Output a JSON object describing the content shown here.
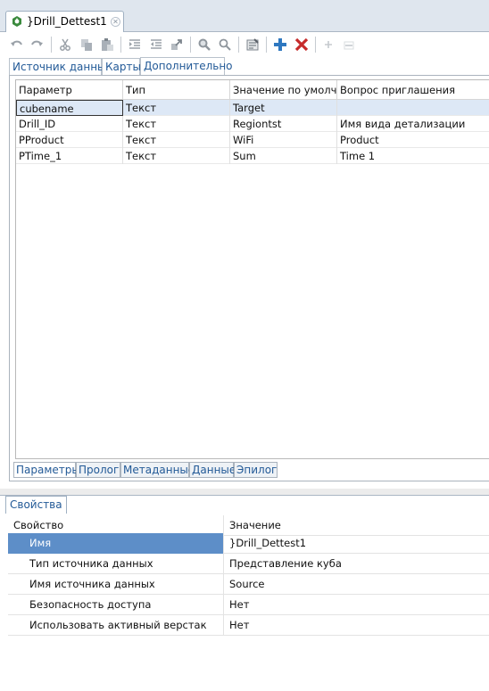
{
  "editor": {
    "tab_title": "}Drill_Dettest1",
    "tabs": [
      "Источник данных",
      "Карты",
      "Дополнительно"
    ],
    "grid": {
      "columns": [
        "Параметр",
        "Тип",
        "Значение по умолча",
        "Вопрос приглашения"
      ],
      "rows": [
        [
          "cubename",
          "Текст",
          "Target",
          ""
        ],
        [
          "Drill_ID",
          "Текст",
          "Regiontst",
          "Имя вида детализации"
        ],
        [
          "PProduct",
          "Текст",
          "WiFi",
          "Product"
        ],
        [
          "PTime_1",
          "Текст",
          "Sum",
          "Time 1"
        ]
      ]
    },
    "bottom_tabs": [
      "Параметры",
      "Пролог",
      "Метаданные",
      "Данные",
      "Эпилог"
    ]
  },
  "properties": {
    "tab_label": "Свойства",
    "columns": [
      "Свойство",
      "Значение"
    ],
    "rows": [
      [
        "Имя",
        "}Drill_Dettest1"
      ],
      [
        "Тип источника данных",
        "Представление куба"
      ],
      [
        "Имя источника данных",
        "Source"
      ],
      [
        "Безопасность доступа",
        "Нет"
      ],
      [
        "Использовать активный верстак",
        "Нет"
      ]
    ]
  }
}
